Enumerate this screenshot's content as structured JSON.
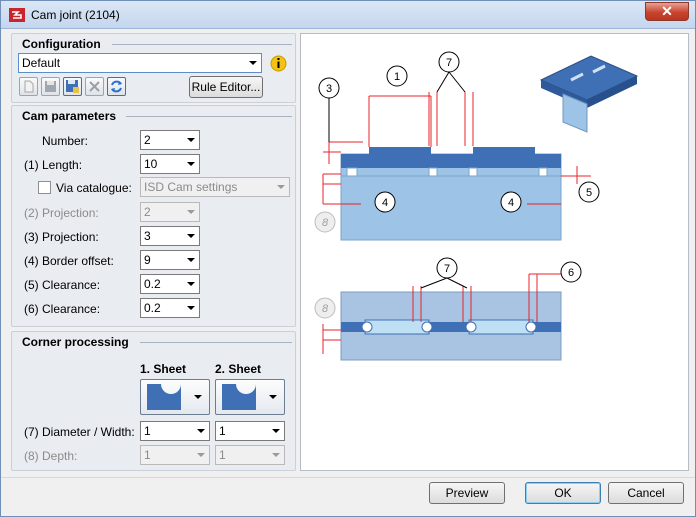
{
  "window": {
    "title": "Cam joint (2104)",
    "close_label": "✕"
  },
  "configuration": {
    "title": "Configuration",
    "selected": "Default",
    "rule_editor_label": "Rule Editor..."
  },
  "cam_parameters": {
    "title": "Cam parameters",
    "number": {
      "label": "Number:",
      "value": "2"
    },
    "length": {
      "label": "(1) Length:",
      "value": "10"
    },
    "via_catalogue": {
      "label": "Via catalogue:",
      "value": "ISD Cam settings",
      "checked": false
    },
    "projection2": {
      "label": "(2) Projection:",
      "value": "2"
    },
    "projection3": {
      "label": "(3) Projection:",
      "value": "3"
    },
    "border_offset": {
      "label": "(4) Border offset:",
      "value": "9"
    },
    "clearance5": {
      "label": "(5) Clearance:",
      "value": "0.2"
    },
    "clearance6": {
      "label": "(6) Clearance:",
      "value": "0.2"
    }
  },
  "corner_processing": {
    "title": "Corner processing",
    "sheet1_header": "1. Sheet",
    "sheet2_header": "2. Sheet",
    "diameter": {
      "label": "(7) Diameter / Width:",
      "sheet1": "1",
      "sheet2": "1"
    },
    "depth": {
      "label": "(8) Depth:",
      "sheet1": "1",
      "sheet2": "1"
    }
  },
  "diagram": {
    "callouts": [
      "1",
      "3",
      "4",
      "4",
      "5",
      "6",
      "7",
      "7",
      "8",
      "8"
    ]
  },
  "footer": {
    "preview_label": "Preview",
    "ok_label": "OK",
    "cancel_label": "Cancel"
  },
  "colors": {
    "accent_blue": "#3f6fb5",
    "plate_blue": "#9dc3e6",
    "dim_red": "#e8232a"
  }
}
